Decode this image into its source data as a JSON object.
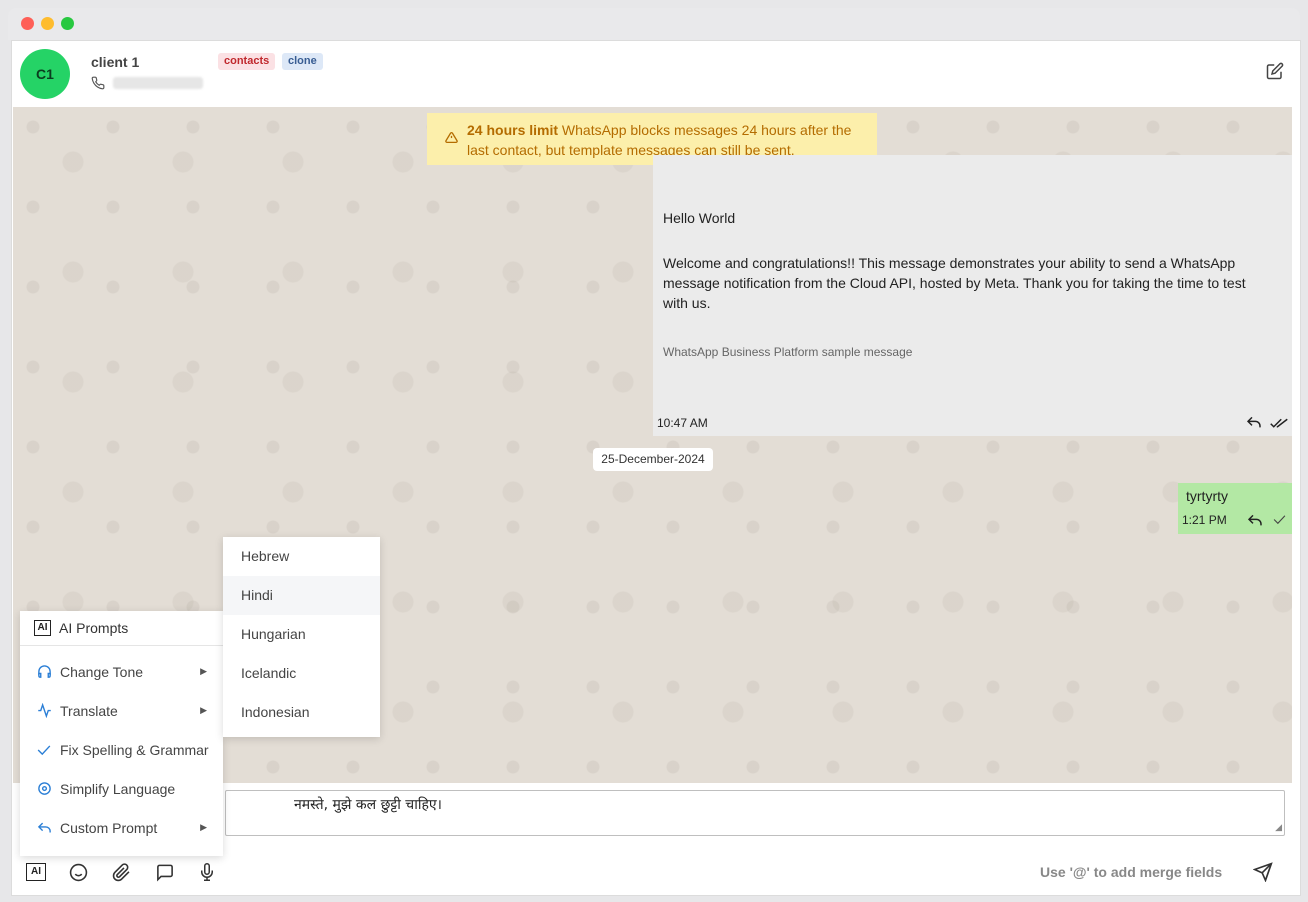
{
  "header": {
    "avatar_initials": "C1",
    "client_name": "client 1",
    "tags": [
      "contacts",
      "clone"
    ]
  },
  "banner": {
    "title": "24 hours limit",
    "text": "WhatsApp blocks messages 24 hours after the last contact, but template messages can still be sent."
  },
  "messages": {
    "template": {
      "greeting": "Hello World",
      "body": "Welcome and congratulations!! This message demonstrates your ability to send a WhatsApp message notification from the Cloud API, hosted by Meta. Thank you for taking the time to test with us.",
      "footer": "WhatsApp Business Platform sample message",
      "time": "10:47 AM"
    },
    "date_separator": "25-December-2024",
    "outgoing": {
      "text": "tyrtyrty",
      "time": "1:21 PM"
    }
  },
  "ai_menu": {
    "title": "AI Prompts",
    "items": [
      {
        "label": "Change Tone",
        "icon": "headphones-icon"
      },
      {
        "label": "Translate",
        "icon": "activity-icon"
      },
      {
        "label": "Fix Spelling & Grammar",
        "icon": "check-icon"
      },
      {
        "label": "Simplify Language",
        "icon": "target-icon"
      },
      {
        "label": "Custom Prompt",
        "icon": "reply-icon"
      }
    ]
  },
  "language_menu": {
    "items": [
      "Hebrew",
      "Hindi",
      "Hungarian",
      "Icelandic",
      "Indonesian"
    ],
    "highlighted": "Hindi"
  },
  "composer": {
    "text": "नमस्ते, मुझे कल छुट्टी चाहिए।",
    "merge_hint": "Use '@' to add merge fields",
    "ai_button": "AI"
  },
  "colors": {
    "avatar": "#25d366",
    "outgoing_bubble": "#b3e8a4",
    "banner_bg": "#fcefab",
    "banner_text": "#b46c00",
    "chat_bg": "#e3ddd5"
  }
}
